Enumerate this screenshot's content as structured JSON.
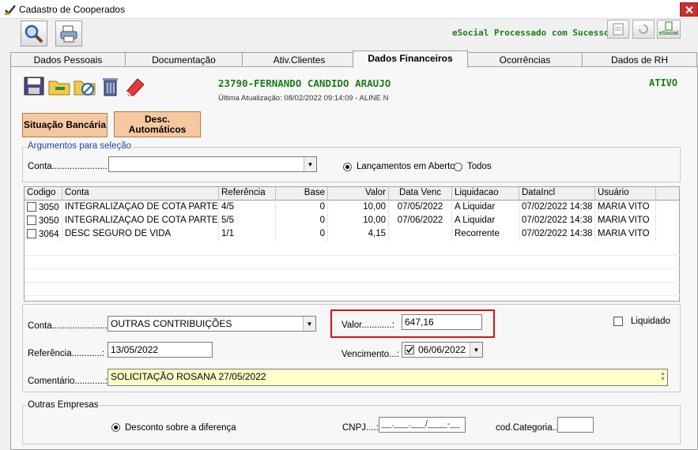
{
  "window": {
    "title": "Cadastro de Cooperados"
  },
  "toolbar": {
    "search_icon": "magnifier-icon",
    "print_icon": "printer-icon"
  },
  "esocial": {
    "status": "eSocial Processado com Sucesso",
    "badge": "eSocial"
  },
  "tabs": [
    {
      "label": "Dados Pessoais"
    },
    {
      "label": "Documentação"
    },
    {
      "label": "Ativ.Clientes"
    },
    {
      "label": "Dados Financeiros"
    },
    {
      "label": "Ocorrências"
    },
    {
      "label": "Dados de RH"
    }
  ],
  "cooperado": {
    "name": "23790-FERNANDO CANDIDO ARAUJO",
    "updated": "Última Atualização: 08/02/2022 09:14:09 - ALINE N",
    "status": "ATIVO"
  },
  "buttons": {
    "situacao": "Situação Bancária",
    "desc_line1": "Desc.",
    "desc_line2": "Automáticos"
  },
  "selecao": {
    "group_label": "Argumentos para seleção",
    "conta_label": "Conta......................:",
    "conta_value": "",
    "radio_aberto": "Lançamentos em Aberto",
    "radio_todos": "Todos",
    "selected": "aberto"
  },
  "grid": {
    "headers": [
      "Codigo",
      "Conta",
      "Referência",
      "Base",
      "Valor",
      "Data Venc",
      "Liquidacao",
      "DataIncl",
      "Usuário"
    ],
    "rows": [
      [
        "3050",
        "INTEGRALIZAÇAO DE COTA PARTE",
        "4/5",
        "0",
        "10,00",
        "07/05/2022",
        "A Liquidar",
        "07/02/2022 14:38",
        "MARIA VITO"
      ],
      [
        "3050",
        "INTEGRALIZAÇAO DE COTA PARTE",
        "5/5",
        "0",
        "10,00",
        "07/06/2022",
        "A Liquidar",
        "07/02/2022 14:38",
        "MARIA VITO"
      ],
      [
        "3064",
        "DESC SEGURO DE VIDA",
        "1/1",
        "0",
        "4,15",
        "",
        "Recorrente",
        "07/02/2022 14:38",
        "MARIA VITO"
      ]
    ]
  },
  "detail": {
    "conta_label": "Conta......................:",
    "conta_value": "OUTRAS CONTRIBUIÇÕES",
    "valor_label": "Valor............:",
    "valor_value": "647,16",
    "liquidado_label": "Liquidado",
    "referencia_label": "Referência............:",
    "referencia_value": "13/05/2022",
    "vencimento_label": "Vencimento...:",
    "vencimento_value": "06/06/2022",
    "comentario_label": "Comentário............:",
    "comentario_value": "SOLICITAÇÃO ROSANA 27/05/2022"
  },
  "outras": {
    "group_label": "Outras Empresas",
    "radio_label": "Desconto sobre a diferença",
    "cnpj_label": "CNPJ....:",
    "cnpj_value": "__.___.___/____-__",
    "categoria_label": "cod.Categoria..:",
    "categoria_value": ""
  },
  "colors": {
    "accent_green": "#1a7d1a",
    "button_orange": "#f6c8a0",
    "highlight_red": "#d6131b"
  }
}
